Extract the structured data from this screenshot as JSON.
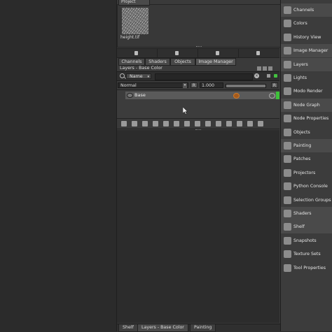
{
  "project": {
    "tab_label": "Project",
    "thumbnail_label": "height.tif"
  },
  "panel_tabs": [
    "Channels",
    "Shaders",
    "Objects",
    "Image Manager"
  ],
  "layers_panel": {
    "title": "Layers - Base Color",
    "filter_field": "Name",
    "blend_mode": "Normal",
    "opacity_toggle": "R",
    "opacity_value": "1.000",
    "opacity_fraction": 1.0,
    "mask_toggle": "R",
    "layers": [
      {
        "name": "Base"
      }
    ]
  },
  "bottom_tabs": [
    "Shelf",
    "Layers - Base Color",
    "Painting"
  ],
  "right_sidebar": {
    "items": [
      {
        "label": "Channels",
        "icon": "channels-icon"
      },
      {
        "label": "Colors",
        "icon": "colors-icon"
      },
      {
        "label": "History View",
        "icon": "history-icon"
      },
      {
        "label": "Image Manager",
        "icon": "image-manager-icon"
      },
      {
        "label": "Layers",
        "icon": "layers-icon"
      },
      {
        "label": "Lights",
        "icon": "lights-icon"
      },
      {
        "label": "Modo Render",
        "icon": "modo-render-icon"
      },
      {
        "label": "Node Graph",
        "icon": "node-graph-icon"
      },
      {
        "label": "Node Properties",
        "icon": "node-properties-icon"
      },
      {
        "label": "Objects",
        "icon": "objects-icon"
      },
      {
        "label": "Painting",
        "icon": "painting-icon"
      },
      {
        "label": "Patches",
        "icon": "patches-icon"
      },
      {
        "label": "Projectors",
        "icon": "projectors-icon"
      },
      {
        "label": "Python Console",
        "icon": "python-console-icon"
      },
      {
        "label": "Selection Groups",
        "icon": "selection-groups-icon"
      },
      {
        "label": "Shaders",
        "icon": "shaders-icon"
      },
      {
        "label": "Shelf",
        "icon": "shelf-icon"
      },
      {
        "label": "Snapshots",
        "icon": "snapshots-icon"
      },
      {
        "label": "Texture Sets",
        "icon": "texture-sets-icon"
      },
      {
        "label": "Tool Properties",
        "icon": "tool-properties-icon"
      }
    ]
  },
  "colors": {
    "accent_green": "#43c140",
    "paint_orange": "#d07a28"
  }
}
